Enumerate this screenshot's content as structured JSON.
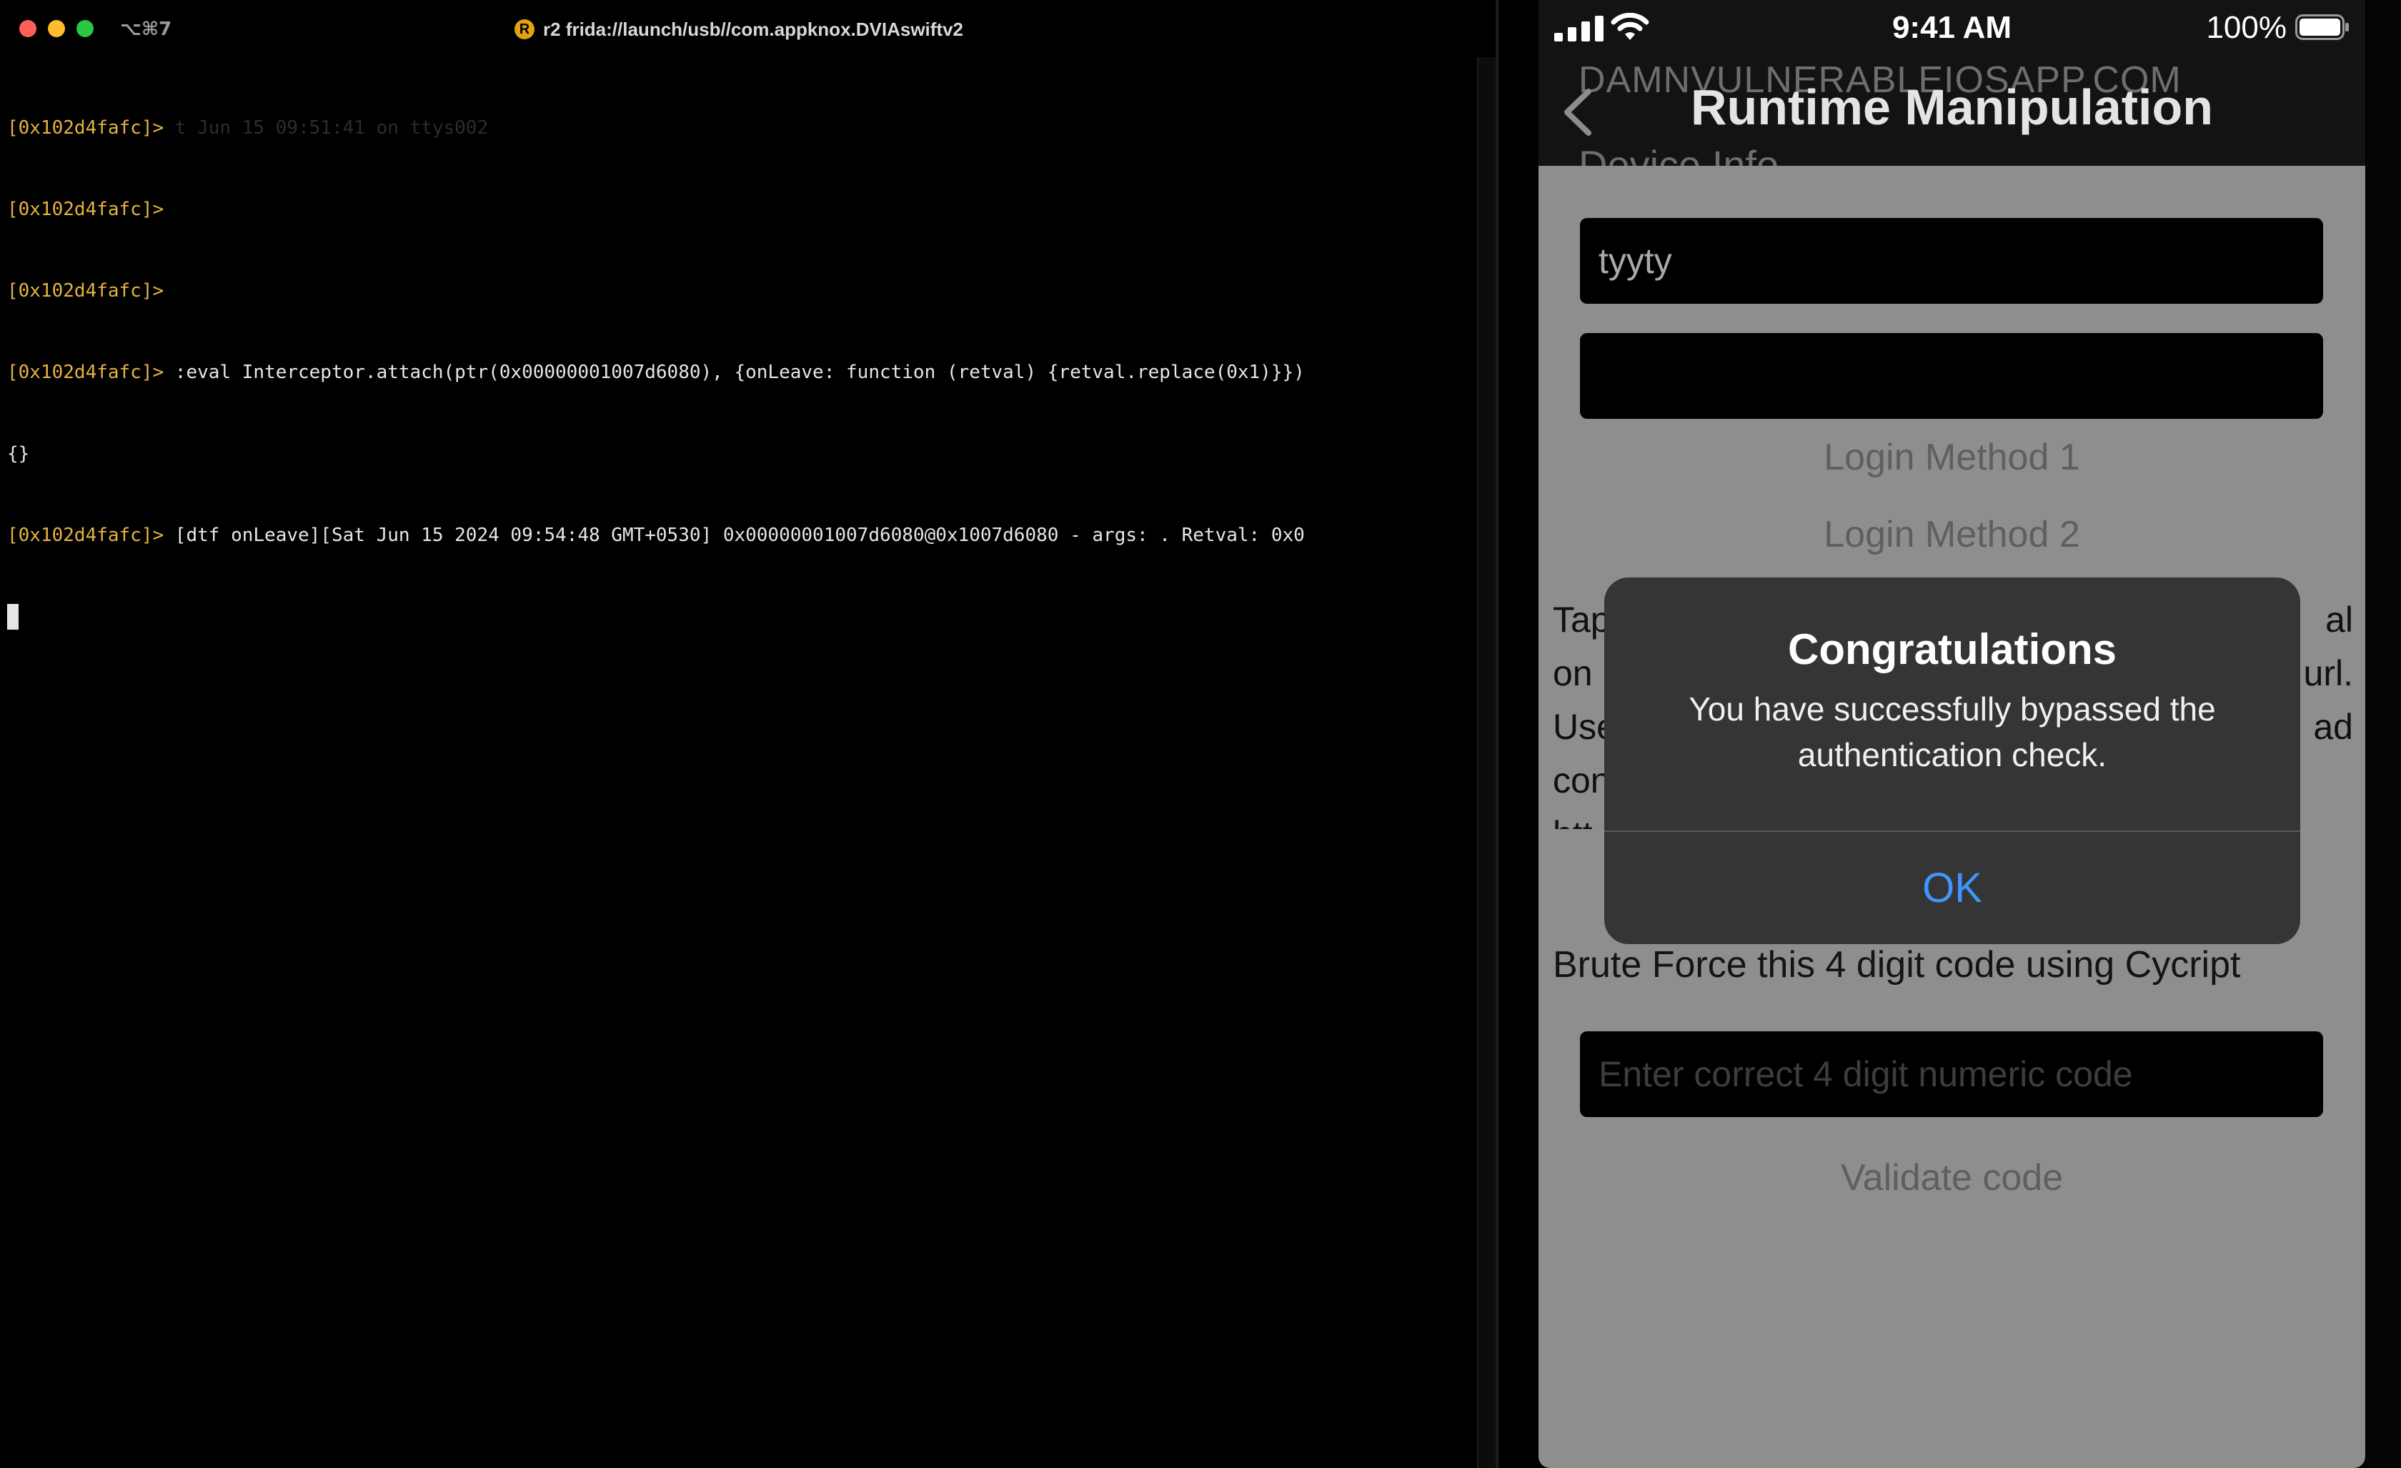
{
  "terminal": {
    "shortcut": "⌥⌘7",
    "badge": "R",
    "title": "r2 frida://launch/usb//com.appknox.DVIAswiftv2",
    "lines": [
      {
        "prompt": "[0x102d4fafc]>",
        "text": " ",
        "ghost": "t Jun 15 09:51:41 on ttys002"
      },
      {
        "prompt": "[0x102d4fafc]>",
        "text": ""
      },
      {
        "prompt": "[0x102d4fafc]>",
        "text": ""
      },
      {
        "prompt": "[0x102d4fafc]>",
        "text": " :eval Interceptor.attach(ptr(0x00000001007d6080), {onLeave: function (retval) {retval.replace(0x1)}})"
      },
      {
        "prompt": "",
        "text": "{}"
      },
      {
        "prompt": "[0x102d4fafc]>",
        "text": " [dtf onLeave][Sat Jun 15 2024 09:54:48 GMT+0530] 0x00000001007d6080@0x1007d6080 - args: . Retval: 0x0"
      }
    ]
  },
  "phone": {
    "status": {
      "time": "9:41 AM",
      "battery": "100%"
    },
    "nav": {
      "title": "Runtime Manipulation",
      "background_text": "DAMNVULNERABLEIOSAPP.COM",
      "background_subtext": "Device Info"
    },
    "username_value": "tyyty",
    "password_value": "",
    "login_method_1": "Login Method 1",
    "login_method_2": "Login Method 2",
    "background_lines": [
      {
        "left": "Tap",
        "right": "al"
      },
      {
        "left": "on",
        "right": "url."
      },
      {
        "left": "Use",
        "right": "ad"
      },
      {
        "left": "con",
        "right": ""
      },
      {
        "left": "htt",
        "right": ""
      }
    ],
    "brute_force_label": "Brute Force this 4 digit code using Cycript",
    "code_placeholder": "Enter correct 4 digit numeric code",
    "validate_button": "Validate code",
    "alert": {
      "title": "Congratulations",
      "message": "You have successfully bypassed the authentication check.",
      "ok_button": "OK"
    }
  }
}
